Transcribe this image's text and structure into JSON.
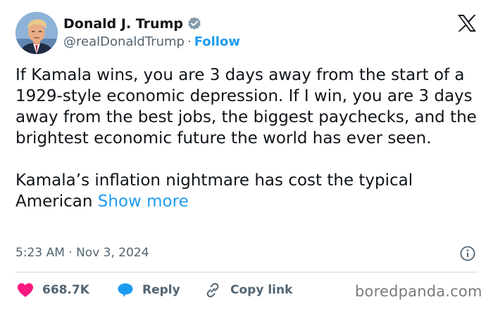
{
  "author": {
    "display_name": "Donald J. Trump",
    "handle": "@realDonaldTrump",
    "separator": "·",
    "follow_label": "Follow",
    "verified_color": "#829aab"
  },
  "tweet": {
    "paragraph_1": "If Kamala wins, you are 3 days away from the start of a 1929-style economic depression. If I win, you are 3 days away from the best jobs, the biggest paychecks, and the brightest economic future the world has ever seen.",
    "paragraph_2": "Kamala’s inflation nightmare has cost the typical American",
    "show_more_label": "Show more",
    "timestamp": "5:23 AM · Nov 3, 2024"
  },
  "actions": {
    "like_count": "668.7K",
    "reply_label": "Reply",
    "copy_link_label": "Copy link"
  },
  "icons": {
    "brand": "x-logo-icon",
    "verified": "verified-badge-icon",
    "info": "info-icon",
    "like": "heart-icon",
    "reply": "speech-bubble-icon",
    "copy": "link-icon"
  },
  "colors": {
    "accent": "#1d9bf0",
    "like": "#f91880",
    "text": "#0f1419",
    "muted": "#536471"
  },
  "watermark": "boredpanda.com"
}
